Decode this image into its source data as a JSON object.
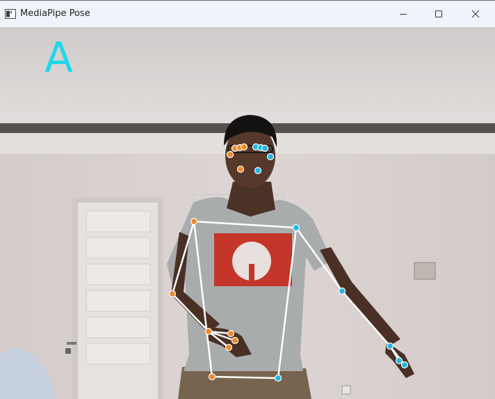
{
  "window": {
    "title": "MediaPipe Pose",
    "icon": "app-window-icon",
    "controls": [
      "minimize-icon",
      "maximize-icon",
      "close-icon"
    ]
  },
  "overlay": {
    "label": "A",
    "label_color": "#1ed8e8"
  },
  "colors": {
    "left_landmark": "#f0892a",
    "right_landmark": "#22b7e0",
    "connection": "#ffffff"
  }
}
